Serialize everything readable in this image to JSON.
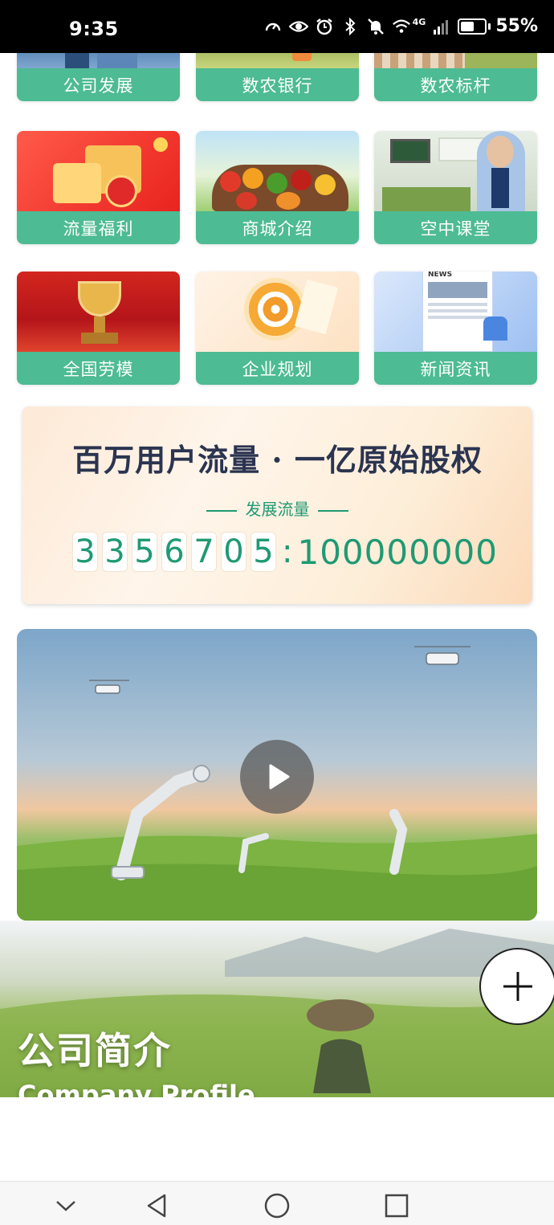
{
  "status_bar": {
    "time": "9:35",
    "network": "4G",
    "battery": "55%",
    "battery_level": 0.55
  },
  "tiles_top_row": [
    {
      "label": "公司发展",
      "icon": "company-development-image"
    },
    {
      "label": "数农银行",
      "icon": "agri-bank-image"
    },
    {
      "label": "数农标杆",
      "icon": "agri-benchmark-image"
    }
  ],
  "tiles_row2": [
    {
      "label": "流量福利",
      "icon": "traffic-welfare-image"
    },
    {
      "label": "商城介绍",
      "icon": "mall-intro-image"
    },
    {
      "label": "空中课堂",
      "icon": "online-classroom-image"
    }
  ],
  "tiles_row3": [
    {
      "label": "全国劳模",
      "icon": "model-worker-trophy-image"
    },
    {
      "label": "企业规划",
      "icon": "enterprise-planning-image"
    },
    {
      "label": "新闻资讯",
      "icon": "news-image"
    }
  ],
  "news_badge": "NEWS",
  "banner": {
    "headline": "百万用户流量 · 一亿原始股权",
    "subtitle": "发展流量",
    "digits": [
      "3",
      "3",
      "5",
      "6",
      "7",
      "0",
      "5"
    ],
    "colon": ":",
    "target": "100000000"
  },
  "video": {
    "icon": "play-icon"
  },
  "profile": {
    "title_cn": "公司简介",
    "title_en": "Company Profile"
  },
  "fab": {
    "icon": "plus-icon"
  },
  "nav": {
    "icons": [
      "chevron-down-icon",
      "back-icon",
      "home-icon",
      "recents-icon"
    ]
  },
  "colors": {
    "tile_label_bg": "#4dbb93",
    "accent_green": "#1f9a73",
    "headline": "#2b3450"
  }
}
